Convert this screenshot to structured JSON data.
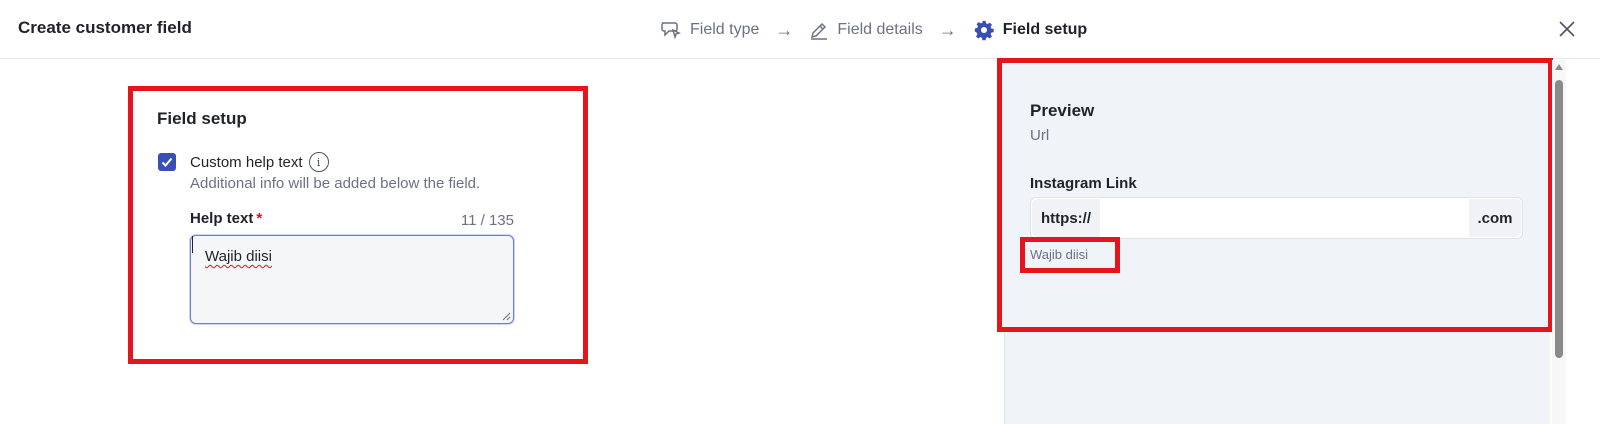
{
  "header": {
    "title": "Create customer field",
    "steps": [
      {
        "label": "Field type",
        "icon": "tag-cursor-icon",
        "state": "done"
      },
      {
        "label": "Field details",
        "icon": "pencil-icon",
        "state": "done"
      },
      {
        "label": "Field setup",
        "icon": "gear-icon",
        "state": "active"
      }
    ],
    "arrow": "→",
    "close_icon": "close-icon"
  },
  "setup": {
    "title": "Field setup",
    "custom_help": {
      "checked": true,
      "label": "Custom help text",
      "info_glyph": "i",
      "description": "Additional info will be added below the field."
    },
    "help_text": {
      "label": "Help text",
      "required_mark": "*",
      "counter": "11 / 135",
      "value": "Wajib diisi"
    }
  },
  "preview": {
    "title": "Preview",
    "subtitle": "Url",
    "field_label": "Instagram Link",
    "prefix": "https://",
    "suffix": ".com",
    "help": "Wajib diisi"
  },
  "colors": {
    "accent": "#3a4fb4",
    "highlight": "#e4151c",
    "required": "#d0142b",
    "preview_bg": "#f0f3f8"
  }
}
